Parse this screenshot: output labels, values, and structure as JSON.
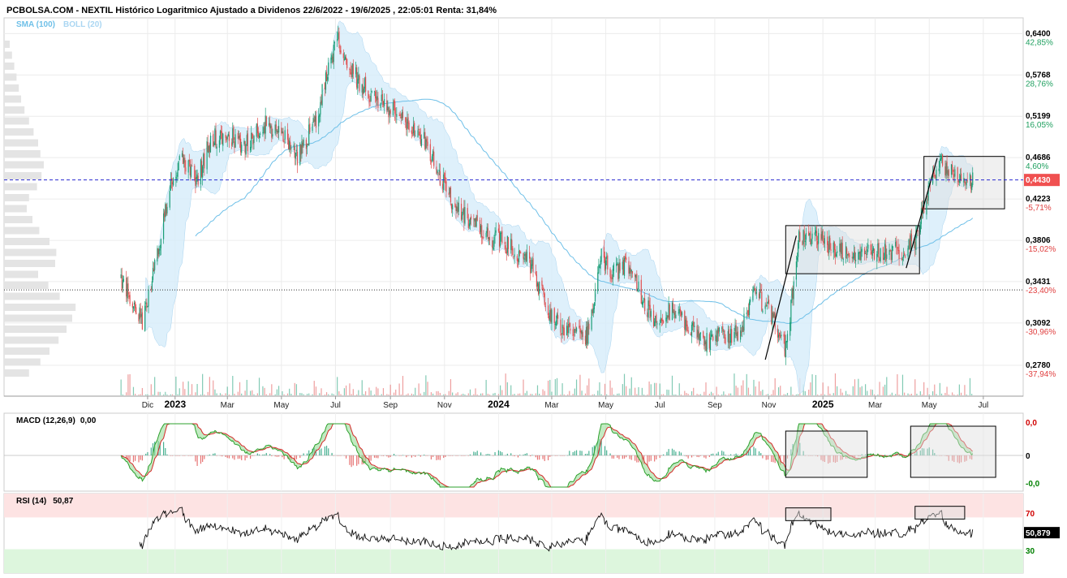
{
  "chart_data": {
    "type": "candlestick",
    "title": "PCBOLSA.COM - NEXTIL Histórico Logaritmico Ajustado a Dividenos 22/6/2022 - 19/6/2025 , 22:05:01 Renta: 31,84%",
    "legend": {
      "sma": "SMA (100)",
      "boll": "BOLL (20)"
    },
    "y_scale": "log",
    "ylim": [
      0.268,
      0.655
    ],
    "price_ticks": [
      {
        "price": "0,6400",
        "pct": "42,85%",
        "dir": "up"
      },
      {
        "price": "0,5768",
        "pct": "28,76%",
        "dir": "up"
      },
      {
        "price": "0,5199",
        "pct": "16,05%",
        "dir": "up"
      },
      {
        "price": "0,4686",
        "pct": "4,60%",
        "dir": "up"
      },
      {
        "price": "0,4223",
        "pct": "-5,71%",
        "dir": "down"
      },
      {
        "price": "0,3806",
        "pct": "-15,02%",
        "dir": "down"
      },
      {
        "price": "0,3431",
        "pct": "-23,40%",
        "dir": "down"
      },
      {
        "price": "0,3092",
        "pct": "-30,96%",
        "dir": "down"
      },
      {
        "price": "0,2780",
        "pct": "-37,94%",
        "dir": "down"
      }
    ],
    "price_tick_values": [
      0.64,
      0.5768,
      0.5199,
      0.4686,
      0.4223,
      0.3806,
      0.3431,
      0.3092,
      0.278
    ],
    "current_price": {
      "value": 0.443,
      "label": "0,4430"
    },
    "reference_price": 0.336,
    "x_labels": [
      {
        "label": "Dic",
        "date": "2022-12-01",
        "kind": "month"
      },
      {
        "label": "2023",
        "date": "2023-01-01",
        "kind": "year"
      },
      {
        "label": "Mar",
        "date": "2023-03-01",
        "kind": "month"
      },
      {
        "label": "May",
        "date": "2023-05-01",
        "kind": "month"
      },
      {
        "label": "Jul",
        "date": "2023-07-01",
        "kind": "month"
      },
      {
        "label": "Sep",
        "date": "2023-09-01",
        "kind": "month"
      },
      {
        "label": "Nov",
        "date": "2023-11-01",
        "kind": "month"
      },
      {
        "label": "2024",
        "date": "2024-01-01",
        "kind": "year"
      },
      {
        "label": "Mar",
        "date": "2024-03-01",
        "kind": "month"
      },
      {
        "label": "May",
        "date": "2024-05-01",
        "kind": "month"
      },
      {
        "label": "Jul",
        "date": "2024-07-01",
        "kind": "month"
      },
      {
        "label": "Sep",
        "date": "2024-09-01",
        "kind": "month"
      },
      {
        "label": "Nov",
        "date": "2024-11-01",
        "kind": "month"
      },
      {
        "label": "2025",
        "date": "2025-01-01",
        "kind": "year"
      },
      {
        "label": "Mar",
        "date": "2025-03-01",
        "kind": "month"
      },
      {
        "label": "May",
        "date": "2025-05-01",
        "kind": "month"
      },
      {
        "label": "Jul",
        "date": "2025-07-01",
        "kind": "month"
      }
    ],
    "date_range": [
      "2022-06-22",
      "2025-08-15"
    ],
    "price_path": [
      [
        "2022-11-01",
        0.345
      ],
      [
        "2022-11-25",
        0.31
      ],
      [
        "2022-12-10",
        0.36
      ],
      [
        "2022-12-25",
        0.43
      ],
      [
        "2023-01-10",
        0.47
      ],
      [
        "2023-01-25",
        0.44
      ],
      [
        "2023-02-10",
        0.49
      ],
      [
        "2023-03-01",
        0.5
      ],
      [
        "2023-03-20",
        0.48
      ],
      [
        "2023-04-10",
        0.51
      ],
      [
        "2023-05-01",
        0.5
      ],
      [
        "2023-05-20",
        0.47
      ],
      [
        "2023-06-10",
        0.52
      ],
      [
        "2023-06-25",
        0.6
      ],
      [
        "2023-07-05",
        0.63
      ],
      [
        "2023-07-20",
        0.58
      ],
      [
        "2023-08-10",
        0.55
      ],
      [
        "2023-09-01",
        0.53
      ],
      [
        "2023-09-25",
        0.51
      ],
      [
        "2023-10-10",
        0.49
      ],
      [
        "2023-10-25",
        0.45
      ],
      [
        "2023-11-10",
        0.42
      ],
      [
        "2023-11-30",
        0.4
      ],
      [
        "2023-12-20",
        0.385
      ],
      [
        "2024-01-15",
        0.375
      ],
      [
        "2024-02-05",
        0.36
      ],
      [
        "2024-02-20",
        0.33
      ],
      [
        "2024-03-05",
        0.31
      ],
      [
        "2024-03-25",
        0.3
      ],
      [
        "2024-04-10",
        0.3
      ],
      [
        "2024-04-25",
        0.365
      ],
      [
        "2024-05-10",
        0.35
      ],
      [
        "2024-05-25",
        0.36
      ],
      [
        "2024-06-10",
        0.33
      ],
      [
        "2024-06-25",
        0.31
      ],
      [
        "2024-07-10",
        0.32
      ],
      [
        "2024-07-30",
        0.31
      ],
      [
        "2024-08-20",
        0.295
      ],
      [
        "2024-09-10",
        0.3
      ],
      [
        "2024-09-30",
        0.3
      ],
      [
        "2024-10-15",
        0.335
      ],
      [
        "2024-11-01",
        0.32
      ],
      [
        "2024-11-20",
        0.29
      ],
      [
        "2024-12-05",
        0.38
      ],
      [
        "2024-12-20",
        0.385
      ],
      [
        "2025-01-10",
        0.375
      ],
      [
        "2025-02-01",
        0.37
      ],
      [
        "2025-03-01",
        0.37
      ],
      [
        "2025-04-01",
        0.37
      ],
      [
        "2025-04-15",
        0.38
      ],
      [
        "2025-05-01",
        0.44
      ],
      [
        "2025-05-15",
        0.46
      ],
      [
        "2025-06-01",
        0.45
      ],
      [
        "2025-06-19",
        0.443
      ]
    ],
    "boxes": [
      {
        "panel": "price",
        "from": "2024-11-20",
        "to": "2025-04-20",
        "high": 0.395,
        "low": 0.35
      },
      {
        "panel": "price",
        "from": "2025-04-25",
        "to": "2025-07-25",
        "high": 0.47,
        "low": 0.412
      },
      {
        "panel": "macd",
        "from": "2024-11-20",
        "to": "2025-02-20",
        "high": 1.0,
        "low": -0.9
      },
      {
        "panel": "macd",
        "from": "2025-04-10",
        "to": "2025-07-15",
        "high": 1.2,
        "low": -0.9
      },
      {
        "panel": "rsi",
        "from": "2024-11-20",
        "to": "2025-01-10",
        "high": 82,
        "low": 66
      },
      {
        "panel": "rsi",
        "from": "2025-04-15",
        "to": "2025-06-10",
        "high": 84,
        "low": 68
      }
    ],
    "trendlines": [
      {
        "from": [
          "2024-10-28",
          0.282
        ],
        "to": [
          "2024-12-02",
          0.385
        ]
      },
      {
        "from": [
          "2025-04-05",
          0.355
        ],
        "to": [
          "2025-05-10",
          0.468
        ]
      }
    ],
    "macd": {
      "label": "MACD (12,26,9)",
      "value": "0,00",
      "ticks": {
        "top": "0,0",
        "zero": "0",
        "bottom": "-0,0"
      }
    },
    "rsi": {
      "label": "RSI (14)",
      "value": "50,87",
      "current_label": "50,879",
      "current": 50.879,
      "levels": {
        "upper": "70",
        "lower": "30"
      }
    },
    "grid": true,
    "colors": {
      "up": "#1b9e77",
      "down": "#e05050",
      "sma": "#6fc0e8",
      "boll_fill": "#d6ecfa",
      "current_price": "#f05050",
      "overbought": "#fde3e3",
      "oversold": "#ddf6dd",
      "macd_line": "#2ca02c",
      "signal_line": "#d62728",
      "hist_up": "#1b9e77",
      "hist_down": "#e05050"
    }
  }
}
